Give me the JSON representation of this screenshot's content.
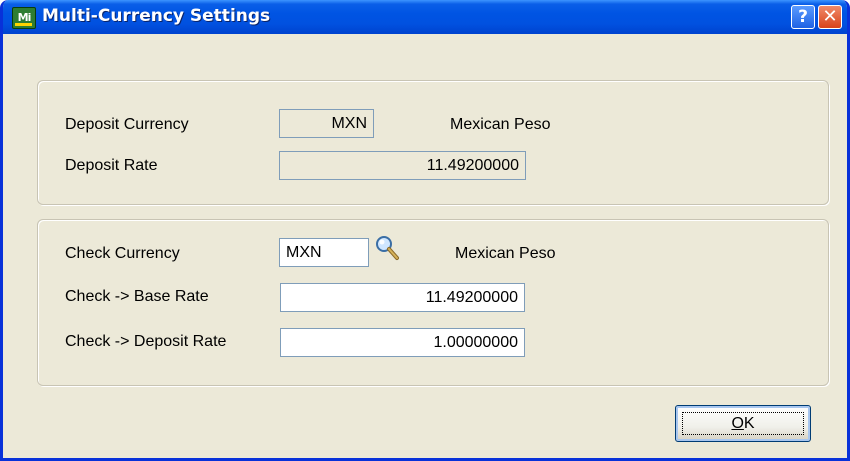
{
  "window": {
    "title": "Multi-Currency Settings",
    "app_icon_text": "Mi",
    "help_button": "?",
    "close_button": "✕"
  },
  "deposit": {
    "currency_label": "Deposit Currency",
    "currency_code": "MXN",
    "currency_name": "Mexican Peso",
    "rate_label": "Deposit Rate",
    "rate_value": "11.49200000"
  },
  "check": {
    "currency_label": "Check Currency",
    "currency_code": "MXN",
    "currency_name": "Mexican Peso",
    "base_rate_label": "Check -> Base Rate",
    "base_rate_value": "11.49200000",
    "deposit_rate_label": "Check -> Deposit Rate",
    "deposit_rate_value": "1.00000000"
  },
  "buttons": {
    "ok_mnemonic": "O",
    "ok_rest": "K"
  },
  "colors": {
    "titlebar": "#0054e3",
    "dialog_bg": "#ece9d8",
    "field_border": "#7f9db9"
  }
}
